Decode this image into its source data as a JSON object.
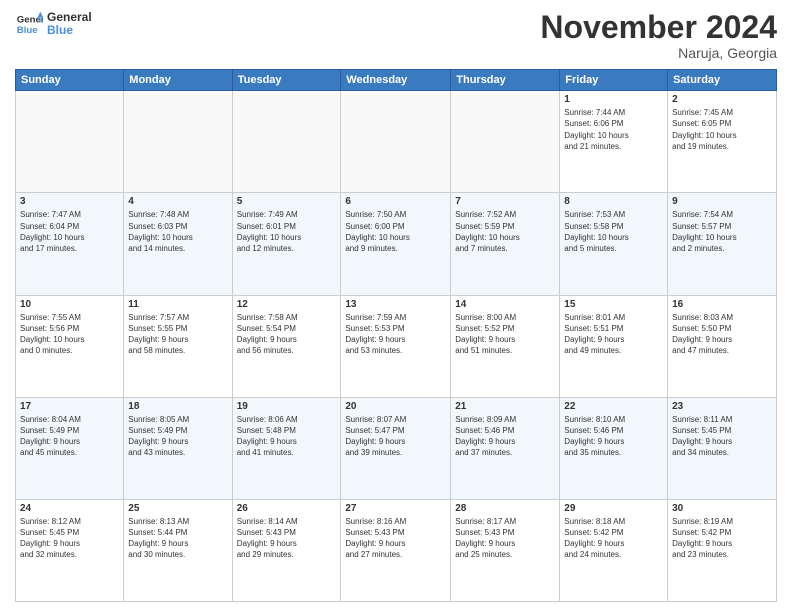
{
  "logo": {
    "line1": "General",
    "line2": "Blue"
  },
  "title": "November 2024",
  "location": "Naruja, Georgia",
  "headers": [
    "Sunday",
    "Monday",
    "Tuesday",
    "Wednesday",
    "Thursday",
    "Friday",
    "Saturday"
  ],
  "weeks": [
    [
      {
        "day": "",
        "info": ""
      },
      {
        "day": "",
        "info": ""
      },
      {
        "day": "",
        "info": ""
      },
      {
        "day": "",
        "info": ""
      },
      {
        "day": "",
        "info": ""
      },
      {
        "day": "1",
        "info": "Sunrise: 7:44 AM\nSunset: 6:06 PM\nDaylight: 10 hours\nand 21 minutes."
      },
      {
        "day": "2",
        "info": "Sunrise: 7:45 AM\nSunset: 6:05 PM\nDaylight: 10 hours\nand 19 minutes."
      }
    ],
    [
      {
        "day": "3",
        "info": "Sunrise: 7:47 AM\nSunset: 6:04 PM\nDaylight: 10 hours\nand 17 minutes."
      },
      {
        "day": "4",
        "info": "Sunrise: 7:48 AM\nSunset: 6:03 PM\nDaylight: 10 hours\nand 14 minutes."
      },
      {
        "day": "5",
        "info": "Sunrise: 7:49 AM\nSunset: 6:01 PM\nDaylight: 10 hours\nand 12 minutes."
      },
      {
        "day": "6",
        "info": "Sunrise: 7:50 AM\nSunset: 6:00 PM\nDaylight: 10 hours\nand 9 minutes."
      },
      {
        "day": "7",
        "info": "Sunrise: 7:52 AM\nSunset: 5:59 PM\nDaylight: 10 hours\nand 7 minutes."
      },
      {
        "day": "8",
        "info": "Sunrise: 7:53 AM\nSunset: 5:58 PM\nDaylight: 10 hours\nand 5 minutes."
      },
      {
        "day": "9",
        "info": "Sunrise: 7:54 AM\nSunset: 5:57 PM\nDaylight: 10 hours\nand 2 minutes."
      }
    ],
    [
      {
        "day": "10",
        "info": "Sunrise: 7:55 AM\nSunset: 5:56 PM\nDaylight: 10 hours\nand 0 minutes."
      },
      {
        "day": "11",
        "info": "Sunrise: 7:57 AM\nSunset: 5:55 PM\nDaylight: 9 hours\nand 58 minutes."
      },
      {
        "day": "12",
        "info": "Sunrise: 7:58 AM\nSunset: 5:54 PM\nDaylight: 9 hours\nand 56 minutes."
      },
      {
        "day": "13",
        "info": "Sunrise: 7:59 AM\nSunset: 5:53 PM\nDaylight: 9 hours\nand 53 minutes."
      },
      {
        "day": "14",
        "info": "Sunrise: 8:00 AM\nSunset: 5:52 PM\nDaylight: 9 hours\nand 51 minutes."
      },
      {
        "day": "15",
        "info": "Sunrise: 8:01 AM\nSunset: 5:51 PM\nDaylight: 9 hours\nand 49 minutes."
      },
      {
        "day": "16",
        "info": "Sunrise: 8:03 AM\nSunset: 5:50 PM\nDaylight: 9 hours\nand 47 minutes."
      }
    ],
    [
      {
        "day": "17",
        "info": "Sunrise: 8:04 AM\nSunset: 5:49 PM\nDaylight: 9 hours\nand 45 minutes."
      },
      {
        "day": "18",
        "info": "Sunrise: 8:05 AM\nSunset: 5:49 PM\nDaylight: 9 hours\nand 43 minutes."
      },
      {
        "day": "19",
        "info": "Sunrise: 8:06 AM\nSunset: 5:48 PM\nDaylight: 9 hours\nand 41 minutes."
      },
      {
        "day": "20",
        "info": "Sunrise: 8:07 AM\nSunset: 5:47 PM\nDaylight: 9 hours\nand 39 minutes."
      },
      {
        "day": "21",
        "info": "Sunrise: 8:09 AM\nSunset: 5:46 PM\nDaylight: 9 hours\nand 37 minutes."
      },
      {
        "day": "22",
        "info": "Sunrise: 8:10 AM\nSunset: 5:46 PM\nDaylight: 9 hours\nand 35 minutes."
      },
      {
        "day": "23",
        "info": "Sunrise: 8:11 AM\nSunset: 5:45 PM\nDaylight: 9 hours\nand 34 minutes."
      }
    ],
    [
      {
        "day": "24",
        "info": "Sunrise: 8:12 AM\nSunset: 5:45 PM\nDaylight: 9 hours\nand 32 minutes."
      },
      {
        "day": "25",
        "info": "Sunrise: 8:13 AM\nSunset: 5:44 PM\nDaylight: 9 hours\nand 30 minutes."
      },
      {
        "day": "26",
        "info": "Sunrise: 8:14 AM\nSunset: 5:43 PM\nDaylight: 9 hours\nand 29 minutes."
      },
      {
        "day": "27",
        "info": "Sunrise: 8:16 AM\nSunset: 5:43 PM\nDaylight: 9 hours\nand 27 minutes."
      },
      {
        "day": "28",
        "info": "Sunrise: 8:17 AM\nSunset: 5:43 PM\nDaylight: 9 hours\nand 25 minutes."
      },
      {
        "day": "29",
        "info": "Sunrise: 8:18 AM\nSunset: 5:42 PM\nDaylight: 9 hours\nand 24 minutes."
      },
      {
        "day": "30",
        "info": "Sunrise: 8:19 AM\nSunset: 5:42 PM\nDaylight: 9 hours\nand 23 minutes."
      }
    ]
  ]
}
